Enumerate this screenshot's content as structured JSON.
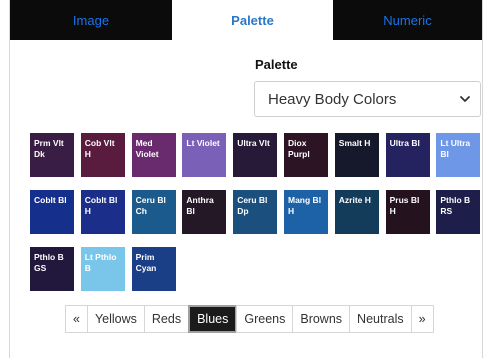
{
  "tabs": [
    "Image",
    "Palette",
    "Numeric"
  ],
  "palette_label": "Palette",
  "palette_select": "Heavy Body Colors",
  "swatches": [
    {
      "label": "Prm Vlt Dk",
      "color": "#3a1d44"
    },
    {
      "label": "Cob Vlt H",
      "color": "#5a1c3e"
    },
    {
      "label": "Med Violet",
      "color": "#6a2b6e"
    },
    {
      "label": "Lt Violet",
      "color": "#7b60b8"
    },
    {
      "label": "Ultra Vlt",
      "color": "#261a38"
    },
    {
      "label": "Diox Purpl",
      "color": "#2c1424"
    },
    {
      "label": "Smalt H",
      "color": "#16192b"
    },
    {
      "label": "Ultra Bl",
      "color": "#252260"
    },
    {
      "label": "Lt Ultra Bl",
      "color": "#6e97e8"
    },
    {
      "label": "Coblt Bl",
      "color": "#152f8c"
    },
    {
      "label": "Coblt Bl H",
      "color": "#1a2e8a"
    },
    {
      "label": "Ceru Bl Ch",
      "color": "#1a5a8c"
    },
    {
      "label": "Anthra Bl",
      "color": "#241826"
    },
    {
      "label": "Ceru Bl Dp",
      "color": "#1b4f7e"
    },
    {
      "label": "Mang Bl H",
      "color": "#1d62a6"
    },
    {
      "label": "Azrite H",
      "color": "#133c5a"
    },
    {
      "label": "Prus Bl H",
      "color": "#24121f"
    },
    {
      "label": "Pthlo B RS",
      "color": "#1d1f4a"
    },
    {
      "label": "Pthlo B GS",
      "color": "#22173d"
    },
    {
      "label": "Lt Pthlo B",
      "color": "#79c6ea"
    },
    {
      "label": "Prim Cyan",
      "color": "#1a3f86"
    }
  ],
  "pager": {
    "prev": "«",
    "items": [
      "Yellows",
      "Reds",
      "Blues",
      "Greens",
      "Browns",
      "Neutrals"
    ],
    "active": "Blues",
    "next": "»"
  }
}
